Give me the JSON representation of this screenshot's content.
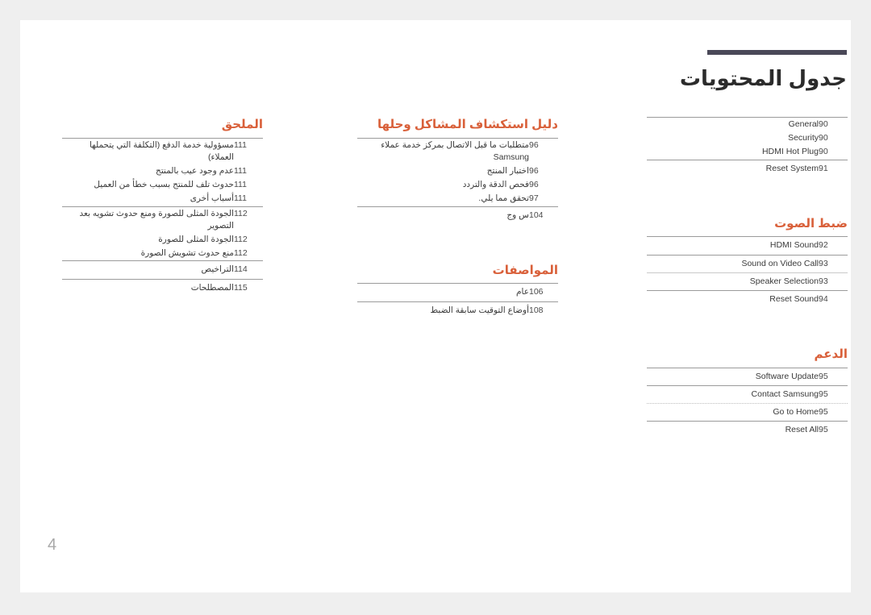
{
  "header": {
    "title": "جدول المحتويات",
    "rule_color": "#4a4858"
  },
  "page_number": "4",
  "accent_color": "#d9603a",
  "columns": {
    "right": [
      {
        "heading": null,
        "groups": [
          {
            "rule": "solid",
            "rows": [
              {
                "title": "General",
                "page": "90",
                "dir": "ltr",
                "tight": true
              },
              {
                "title": "Security",
                "page": "90",
                "dir": "ltr",
                "tight": true
              },
              {
                "title": "HDMI Hot Plug",
                "page": "90",
                "dir": "ltr",
                "tight": true
              }
            ]
          },
          {
            "rule": "solid",
            "rows": [
              {
                "title": "Reset System",
                "page": "91",
                "dir": "ltr",
                "tight": false
              }
            ]
          }
        ]
      },
      {
        "heading": "ضبط الصوت",
        "groups": [
          {
            "rule": "solid",
            "rows": [
              {
                "title": "HDMI Sound",
                "page": "92",
                "dir": "ltr",
                "tight": false
              }
            ]
          },
          {
            "rule": "solid",
            "rows": [
              {
                "title": "Sound on Video Call",
                "page": "93",
                "dir": "ltr",
                "tight": false
              }
            ]
          },
          {
            "rule": "soft",
            "rows": [
              {
                "title": "Speaker Selection",
                "page": "93",
                "dir": "ltr",
                "tight": false
              }
            ]
          },
          {
            "rule": "solid",
            "rows": [
              {
                "title": "Reset Sound",
                "page": "94",
                "dir": "ltr",
                "tight": false
              }
            ]
          }
        ]
      },
      {
        "heading": "الدعم",
        "groups": [
          {
            "rule": "solid",
            "rows": [
              {
                "title": "Software Update",
                "page": "95",
                "dir": "ltr",
                "tight": false
              }
            ]
          },
          {
            "rule": "solid",
            "rows": [
              {
                "title": "Contact Samsung",
                "page": "95",
                "dir": "ltr",
                "tight": false
              }
            ]
          },
          {
            "rule": "dotted",
            "rows": [
              {
                "title": "Go to Home",
                "page": "95",
                "dir": "ltr",
                "tight": false
              }
            ]
          },
          {
            "rule": "solid",
            "rows": [
              {
                "title": "Reset All",
                "page": "95",
                "dir": "ltr",
                "tight": false
              }
            ]
          }
        ]
      }
    ],
    "middle": [
      {
        "heading": "دليل استكشاف المشاكل وحلها",
        "groups": [
          {
            "rule": "solid",
            "rows": [
              {
                "title": "متطلبات ما قبل الاتصال بمركز خدمة عملاء Samsung",
                "page": "96",
                "dir": "rtl",
                "tight": true
              },
              {
                "title": "اختبار المنتج",
                "page": "96",
                "dir": "rtl",
                "tight": true
              },
              {
                "title": "فحص الدقة والتردد",
                "page": "96",
                "dir": "rtl",
                "tight": true
              },
              {
                "title": "تحقق مما يلي.",
                "page": "97",
                "dir": "rtl",
                "tight": true
              }
            ]
          },
          {
            "rule": "solid",
            "rows": [
              {
                "title": "س وج",
                "page": "104",
                "dir": "rtl",
                "tight": false
              }
            ]
          }
        ]
      },
      {
        "heading": "المواصفات",
        "groups": [
          {
            "rule": "solid",
            "rows": [
              {
                "title": "عام",
                "page": "106",
                "dir": "rtl",
                "tight": false
              }
            ]
          },
          {
            "rule": "solid",
            "rows": [
              {
                "title": "أوضاع التوقيت سابقة الضبط",
                "page": "108",
                "dir": "rtl",
                "tight": false
              }
            ]
          }
        ]
      }
    ],
    "left": [
      {
        "heading": "الملحق",
        "groups": [
          {
            "rule": "solid",
            "rows": [
              {
                "title": "مسؤولية خدمة الدفع (التكلفة التي يتحملها العملاء)",
                "page": "111",
                "dir": "rtl",
                "tight": true
              },
              {
                "title": "عدم وجود عيب بالمنتج",
                "page": "111",
                "dir": "rtl",
                "tight": true
              },
              {
                "title": "حدوث تلف للمنتج بسبب خطأ من العميل",
                "page": "111",
                "dir": "rtl",
                "tight": true
              },
              {
                "title": "أسباب أخرى",
                "page": "111",
                "dir": "rtl",
                "tight": true
              }
            ]
          },
          {
            "rule": "solid",
            "rows": [
              {
                "title": "الجودة المثلى للصورة ومنع حدوث تشويه بعد التصوير",
                "page": "112",
                "dir": "rtl",
                "tight": true
              },
              {
                "title": "الجودة المثلى للصورة",
                "page": "112",
                "dir": "rtl",
                "tight": true
              },
              {
                "title": "منع حدوث تشويش الصورة",
                "page": "112",
                "dir": "rtl",
                "tight": true
              }
            ]
          },
          {
            "rule": "solid",
            "rows": [
              {
                "title": "التراخيص",
                "page": "114",
                "dir": "rtl",
                "tight": false
              }
            ]
          },
          {
            "rule": "solid",
            "rows": [
              {
                "title": "المصطلحات",
                "page": "115",
                "dir": "rtl",
                "tight": false
              }
            ]
          }
        ]
      }
    ]
  }
}
